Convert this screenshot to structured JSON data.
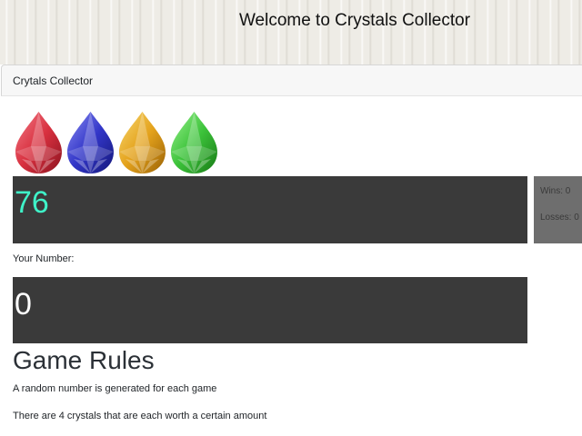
{
  "header": {
    "title": "Welcome to Crystals Collector"
  },
  "card": {
    "title": "Crytals Collector"
  },
  "crystals": [
    {
      "name": "red-crystal-icon",
      "color": "#d8303f"
    },
    {
      "name": "blue-crystal-icon",
      "color": "#3236c8"
    },
    {
      "name": "yellow-crystal-icon",
      "color": "#e4a21c"
    },
    {
      "name": "green-crystal-icon",
      "color": "#3cc23a"
    }
  ],
  "game": {
    "target_number": "76",
    "wins_label": "Wins: 0",
    "losses_label": "Losses: 0",
    "your_number_label": "Your Number:",
    "your_number": "0"
  },
  "rules": {
    "title": "Game Rules",
    "items": [
      "A random number is generated for each game",
      "There are 4 crystals that are each worth a certain amount"
    ]
  }
}
